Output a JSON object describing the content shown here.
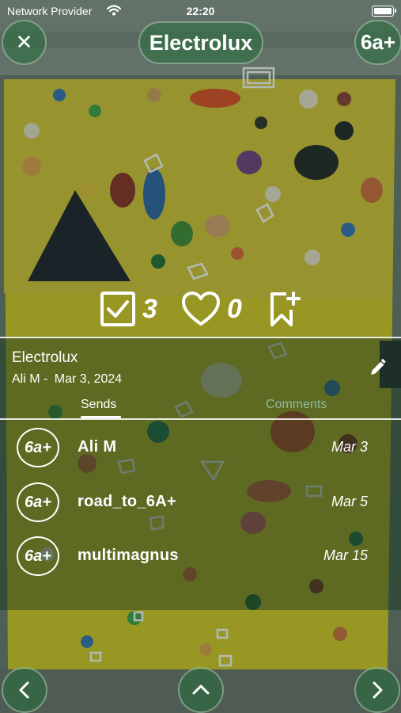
{
  "status_bar": {
    "carrier": "Network Provider",
    "time": "22:20"
  },
  "header": {
    "close_symbol": "✕",
    "title": "Electrolux",
    "grade": "6a+"
  },
  "stats": {
    "sends_count": "3",
    "likes_count": "0"
  },
  "route": {
    "name": "Electrolux",
    "author": "Ali M",
    "separator": "-",
    "date": "Mar 3, 2024"
  },
  "tabs": [
    {
      "label": "Sends",
      "active": true
    },
    {
      "label": "Comments",
      "active": false
    }
  ],
  "sends": [
    {
      "grade": "6a+",
      "user": "Ali M",
      "date": "Mar 3"
    },
    {
      "grade": "6a+",
      "user": "road_to_6A+",
      "date": "Mar 5"
    },
    {
      "grade": "6a+",
      "user": "multimagnus",
      "date": "Mar 15"
    }
  ],
  "bottom_nav": {
    "prev": "chevron-left-icon",
    "up": "chevron-up-icon",
    "next": "chevron-right-icon"
  },
  "colors": {
    "wall": "#d8cc2a",
    "accent": "#2e7d4a",
    "comments_tab": "#8fb9a0"
  }
}
